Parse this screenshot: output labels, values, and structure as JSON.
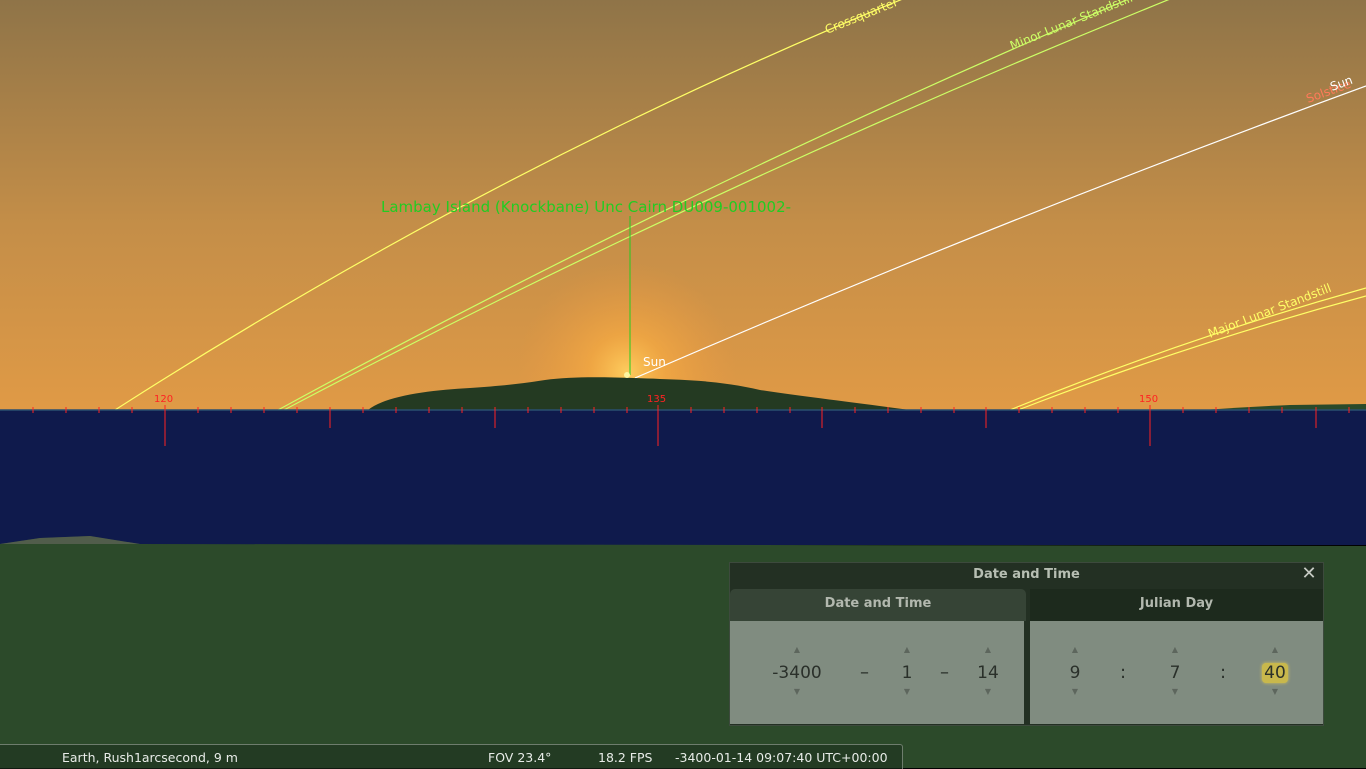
{
  "sky": {
    "location_label": "Lambay Island (Knockbane) Unc Cairn DU009-001002-",
    "sun_label": "Sun",
    "lines": [
      {
        "label": "Crossquarter",
        "color": "#ffff66"
      },
      {
        "label": "Minor Lunar Standstill",
        "color": "#ccff66"
      },
      {
        "label": "Solstice",
        "color": "#ff7a5a"
      },
      {
        "label": "Sun",
        "color": "#ffffff"
      },
      {
        "label": "Major Lunar Standstill",
        "color": "#ffff66"
      }
    ],
    "azimuth_labels": [
      "120",
      "135",
      "150"
    ]
  },
  "status": {
    "location": "Earth, Rush1arcsecond, 9 m",
    "fov": "FOV 23.4°",
    "fps": "18.2 FPS",
    "datetime": "-3400-01-14 09:07:40 UTC+00:00"
  },
  "dialog": {
    "title": "Date and Time",
    "close_glyph": "✕",
    "tabs": [
      "Date and Time",
      "Julian Day"
    ],
    "date": {
      "year": "-3400",
      "month": "1",
      "day": "14",
      "sep": "–"
    },
    "time": {
      "hour": "9",
      "minute": "7",
      "second": "40",
      "sep": ":"
    },
    "arrow_up": "▲",
    "arrow_down": "▼"
  },
  "colors": {
    "ground": "#2c4a2a",
    "water": "#0f1a4c",
    "label_green": "#22cc22",
    "grid_red": "#ff2222"
  }
}
